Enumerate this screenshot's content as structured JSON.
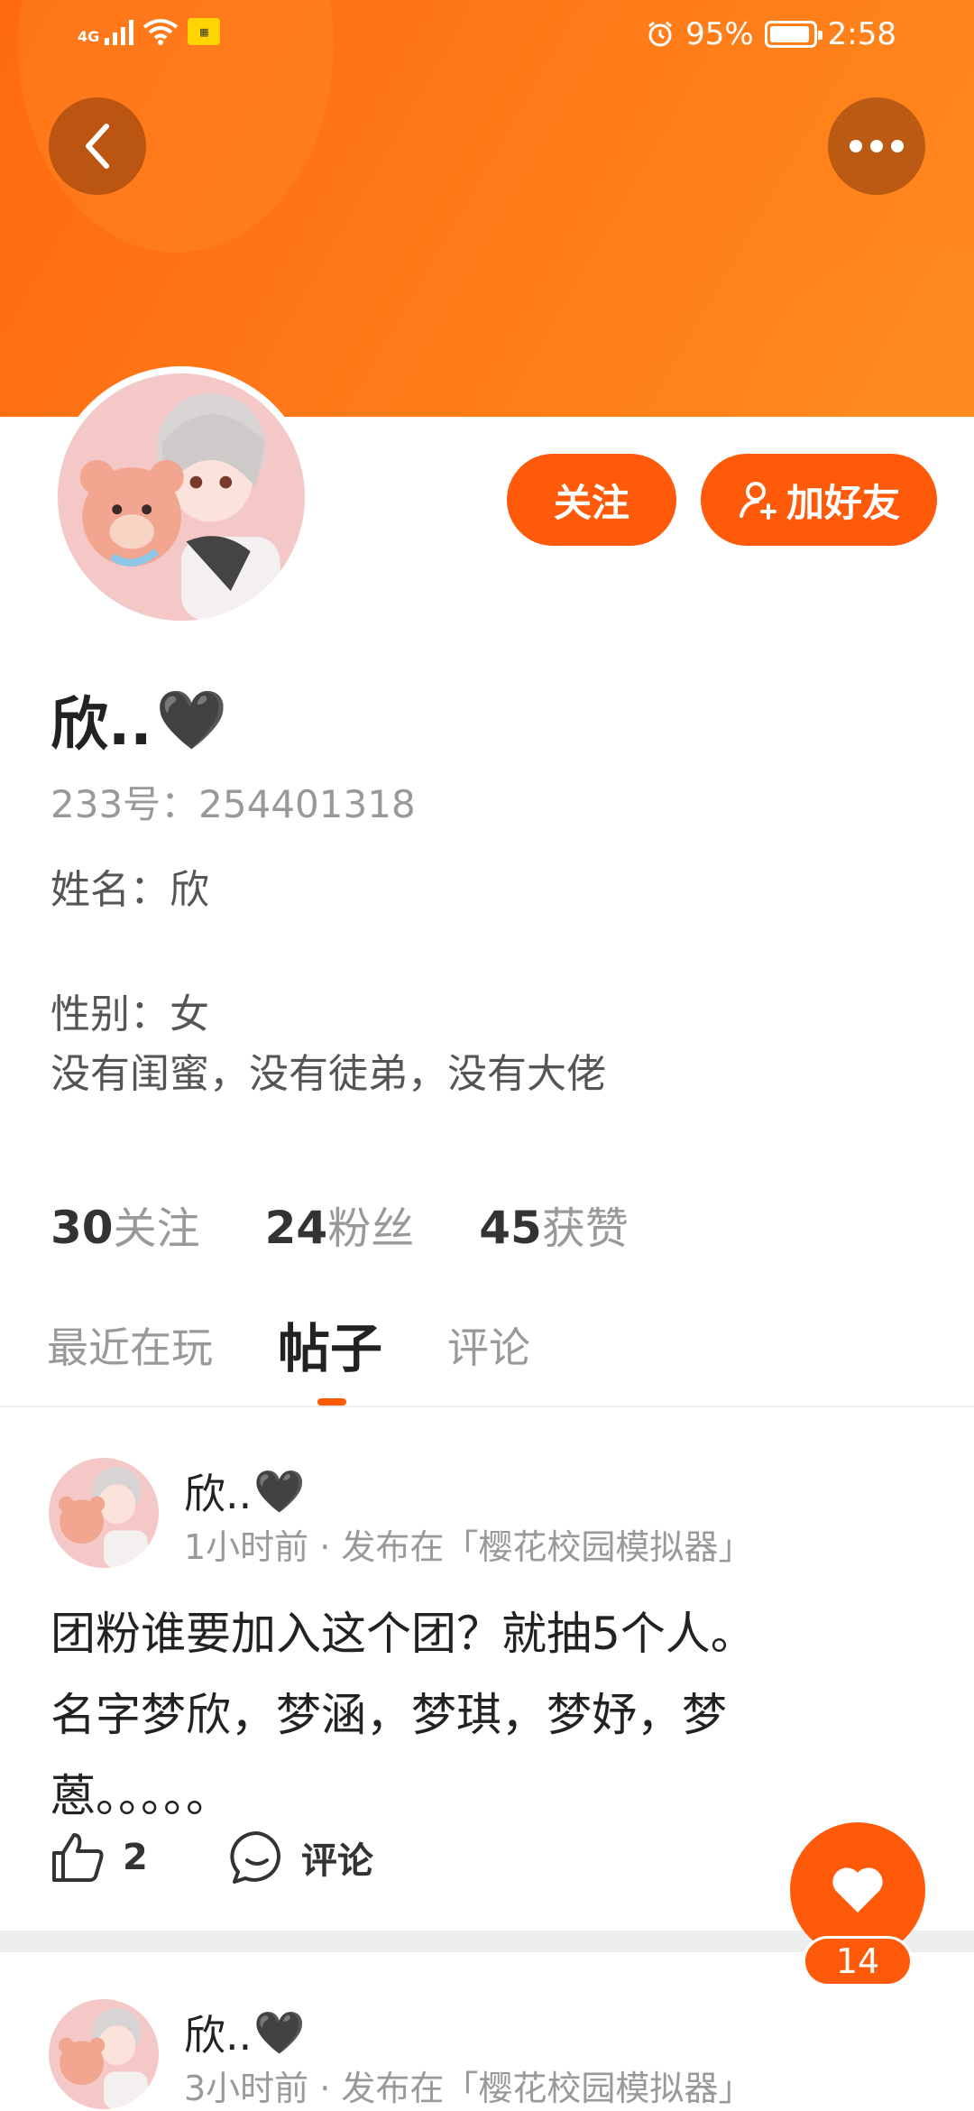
{
  "status_bar": {
    "network": "4G",
    "battery": "95%",
    "time": "2:58",
    "battery_level": 0.95
  },
  "header": {
    "back_icon": "chevron-left-icon",
    "more_icon": "more-dots-icon",
    "bg_color": "#ff7a18"
  },
  "profile": {
    "name": "欣..",
    "name_emoji": "🖤",
    "id_text": "233号：254401318",
    "bio": [
      "姓名：欣",
      "",
      "性别：女",
      "没有闺蜜，没有徒弟，没有大佬"
    ]
  },
  "actions": {
    "follow_label": "关注",
    "add_friend_label": "加好友",
    "accent": "#ff5a0a"
  },
  "stats": [
    {
      "num": "30",
      "label": "关注"
    },
    {
      "num": "24",
      "label": "粉丝"
    },
    {
      "num": "45",
      "label": "获赞"
    }
  ],
  "tabs": [
    {
      "label": "最近在玩",
      "active": false
    },
    {
      "label": "帖子",
      "active": true
    },
    {
      "label": "评论",
      "active": false
    }
  ],
  "posts": [
    {
      "author": "欣..",
      "author_emoji": "🖤",
      "meta": "1小时前 · 发布在「樱花校园模拟器」",
      "body_lines": [
        "团粉谁要加入这个团？就抽5个人。",
        "名字梦欣，梦涵，梦琪，梦妤，梦",
        "蒽。。。。。"
      ],
      "likes": "2",
      "comment_label": "评论"
    },
    {
      "author": "欣..",
      "author_emoji": "🖤",
      "meta": "3小时前 · 发布在「樱花校园模拟器」"
    }
  ],
  "floating_like": {
    "count": "14",
    "icon": "heart-icon"
  }
}
